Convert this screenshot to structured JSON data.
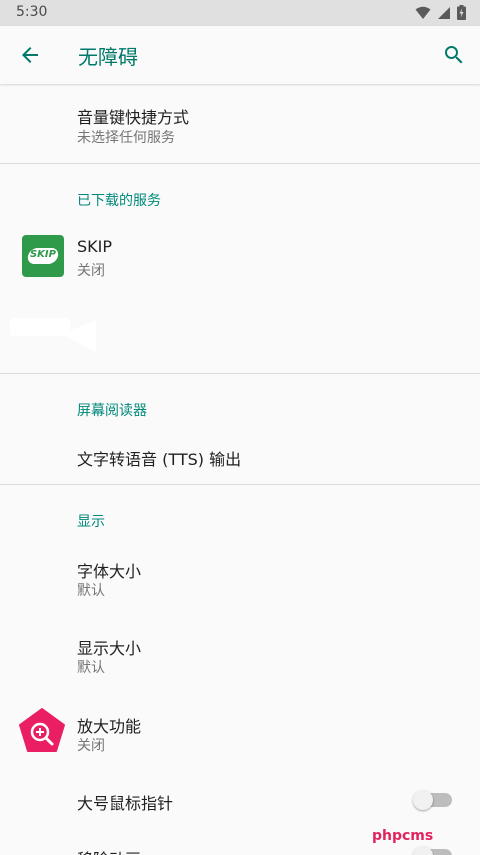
{
  "status_bar": {
    "time": "5:30"
  },
  "app_bar": {
    "title": "无障碍"
  },
  "items": {
    "volume_shortcut": {
      "title": "音量键快捷方式",
      "summary": "未选择任何服务"
    },
    "downloaded_services_header": "已下载的服务",
    "skip": {
      "title": "SKIP",
      "summary": "关闭",
      "icon_text": "SKIP"
    },
    "screen_reader_header": "屏幕阅读器",
    "tts": {
      "title": "文字转语音 (TTS) 输出"
    },
    "display_header": "显示",
    "font_size": {
      "title": "字体大小",
      "summary": "默认"
    },
    "display_size": {
      "title": "显示大小",
      "summary": "默认"
    },
    "magnification": {
      "title": "放大功能",
      "summary": "关闭"
    },
    "large_pointer": {
      "title": "大号鼠标指针"
    },
    "remove_animations": {
      "title": "移除动画"
    }
  },
  "watermark": "phpcms",
  "colors": {
    "accent": "#00796b",
    "section": "#00897b",
    "skip_icon": "#2e9a4a",
    "magnify_icon": "#e91e63"
  }
}
